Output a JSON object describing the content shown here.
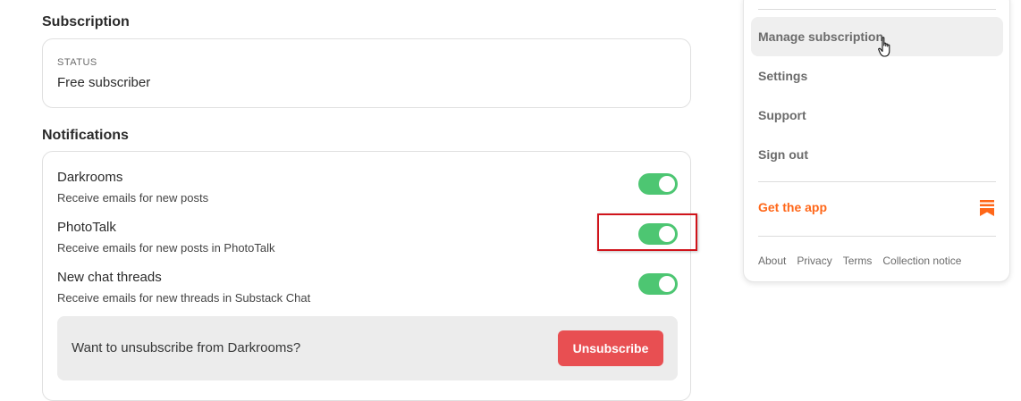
{
  "subscription": {
    "title": "Subscription",
    "status_label": "STATUS",
    "status_value": "Free subscriber"
  },
  "notifications": {
    "title": "Notifications",
    "items": [
      {
        "title": "Darkrooms",
        "description": "Receive emails for new posts",
        "enabled": true
      },
      {
        "title": "PhotoTalk",
        "description": "Receive emails for new posts in PhotoTalk",
        "enabled": true
      },
      {
        "title": "New chat threads",
        "description": "Receive emails for new threads in Substack Chat",
        "enabled": true
      }
    ],
    "unsubscribe_prompt": "Want to unsubscribe from Darkrooms?",
    "unsubscribe_label": "Unsubscribe"
  },
  "menu": {
    "items": [
      {
        "label": "Manage subscription",
        "active": true
      },
      {
        "label": "Settings",
        "active": false
      },
      {
        "label": "Support",
        "active": false
      },
      {
        "label": "Sign out",
        "active": false
      }
    ],
    "get_app": "Get the app",
    "footer_links": [
      "About",
      "Privacy",
      "Terms",
      "Collection notice"
    ]
  },
  "colors": {
    "toggle_on": "#4dc672",
    "unsubscribe_button": "#e84f52",
    "brand_orange": "#ff6719",
    "highlight": "#d0141b"
  },
  "icons": {
    "app_icon": "substack-logo-icon",
    "cursor": "hand-pointer-icon"
  }
}
